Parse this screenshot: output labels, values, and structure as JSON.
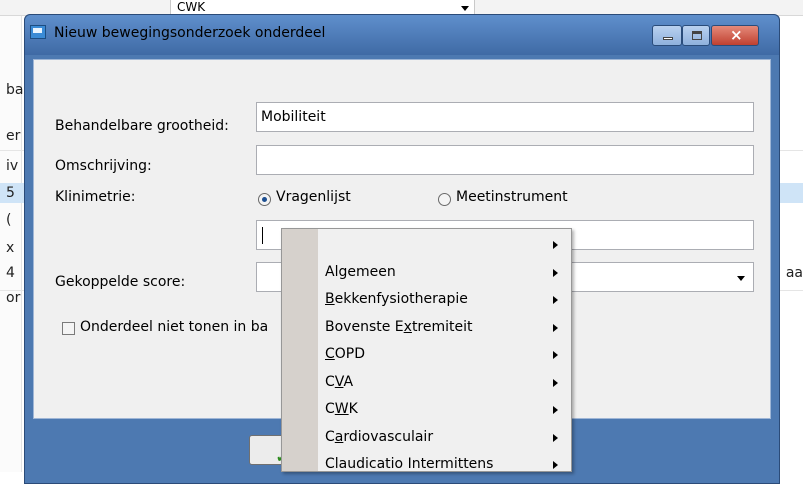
{
  "background": {
    "combo_value": "CWK",
    "left_fragments": [
      "ba",
      "er",
      "iv",
      "5",
      "(",
      "x",
      "4",
      "or"
    ],
    "right_fragment": "aa"
  },
  "dialog": {
    "title": "Nieuw bewegingsonderzoek onderdeel",
    "controls": {
      "minimize": "–",
      "maximize": "□",
      "close": "×"
    }
  },
  "form": {
    "behandelbare_label": "Behandelbare grootheid:",
    "behandelbare_value": "Mobiliteit",
    "omschrijving_label": "Omschrijving:",
    "omschrijving_value": "",
    "klinimetrie_label": "Klinimetrie:",
    "radio_vragenlijst": "Vragenlijst",
    "radio_meetinstrument": "Meetinstrument",
    "selected_radio": "Vragenlijst",
    "klinimetrie_value": "",
    "gekoppelde_label": "Gekoppelde score:",
    "gekoppelde_value": "",
    "checkbox_label": "Onderdeel niet tonen in ba",
    "checkbox_checked": false
  },
  "menu": {
    "items": [
      {
        "pre": "",
        "ul": "",
        "post": ""
      },
      {
        "pre": "Algemeen",
        "ul": "",
        "post": ""
      },
      {
        "pre": "",
        "ul": "B",
        "post": "ekkenfysiotherapie"
      },
      {
        "pre": "Bovenste E",
        "ul": "x",
        "post": "tremiteit"
      },
      {
        "pre": "",
        "ul": "C",
        "post": "OPD"
      },
      {
        "pre": "C",
        "ul": "V",
        "post": "A"
      },
      {
        "pre": "C",
        "ul": "W",
        "post": "K"
      },
      {
        "pre": "C",
        "ul": "a",
        "post": "rdiovasculair"
      },
      {
        "pre": "Claudicatio Intermittens",
        "ul": "",
        "post": ""
      }
    ]
  },
  "colors": {
    "dialog_frame": "#4d79b1",
    "client_bg": "#f0f0f0",
    "menu_gutter": "#d6d1cc",
    "selection_row": "#cfe4f7"
  }
}
